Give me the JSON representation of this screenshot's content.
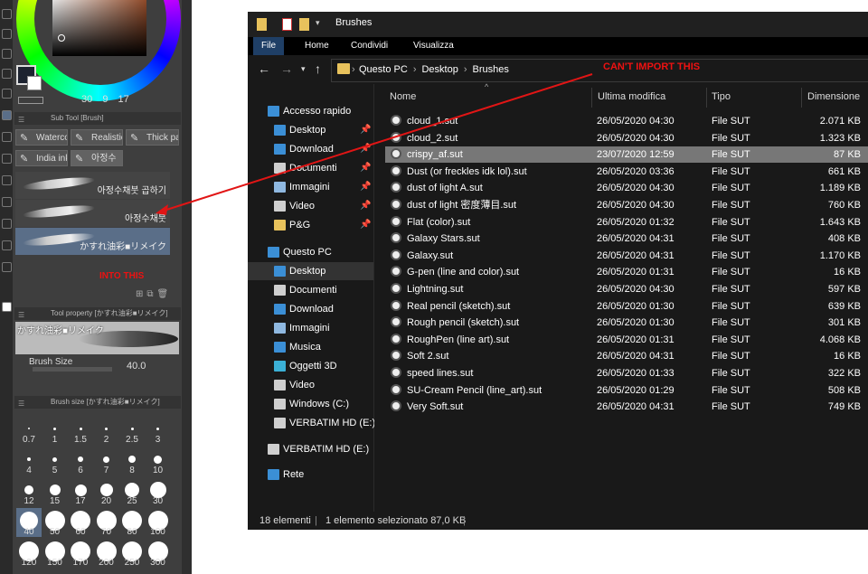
{
  "csp": {
    "color_values": [
      "30",
      "9",
      "17"
    ],
    "subtool_panel_title": "Sub Tool [Brush]",
    "tabs_row1": [
      "Watercolor",
      "Realistic",
      "Thick paint"
    ],
    "tabs_row2": [
      "India ink",
      "아정수"
    ],
    "brushes": [
      "아정수채붓 곱하기",
      "아정수채붓",
      "かすれ油彩■リメイク"
    ],
    "selected_brush": "かすれ油彩■リメイク",
    "into_this_label": "INTO THIS",
    "property_panel_title": "Tool property [かすれ油彩■リメイク]",
    "property_preview_label": "かすれ油彩■リメイク",
    "brush_size_label": "Brush Size",
    "brush_size_value": "40.0",
    "brush_size_panel_title": "Brush size [かすれ油彩■リメイク]",
    "sizes": [
      "0.7",
      "1",
      "1.5",
      "2",
      "2.5",
      "3",
      "4",
      "5",
      "6",
      "7",
      "8",
      "10",
      "12",
      "15",
      "17",
      "20",
      "25",
      "30",
      "40",
      "50",
      "60",
      "70",
      "80",
      "100",
      "120",
      "150",
      "170",
      "200",
      "250",
      "300"
    ],
    "selected_size": "40"
  },
  "explorer": {
    "title": "Brushes",
    "ribbon": [
      "File",
      "Home",
      "Condividi",
      "Visualizza"
    ],
    "breadcrumb": [
      "Questo PC",
      "Desktop",
      "Brushes"
    ],
    "nav": {
      "quick_access": "Accesso rapido",
      "quick_items": [
        "Desktop",
        "Download",
        "Documenti",
        "Immagini",
        "Video",
        "P&G"
      ],
      "this_pc": "Questo PC",
      "pc_items": [
        "Desktop",
        "Documenti",
        "Download",
        "Immagini",
        "Musica",
        "Oggetti 3D",
        "Video",
        "Windows (C:)",
        "VERBATIM HD (E:)"
      ],
      "verbatim": "VERBATIM HD (E:)",
      "network": "Rete"
    },
    "columns": [
      "Nome",
      "Ultima modifica",
      "Tipo",
      "Dimensione"
    ],
    "files": [
      {
        "name": "cloud_1.sut",
        "date": "26/05/2020 04:30",
        "type": "File SUT",
        "size": "2.071 KB"
      },
      {
        "name": "cloud_2.sut",
        "date": "26/05/2020 04:30",
        "type": "File SUT",
        "size": "1.323 KB"
      },
      {
        "name": "crispy_af.sut",
        "date": "23/07/2020 12:59",
        "type": "File SUT",
        "size": "87 KB"
      },
      {
        "name": "Dust (or freckles idk lol).sut",
        "date": "26/05/2020 03:36",
        "type": "File SUT",
        "size": "661 KB"
      },
      {
        "name": "dust of light A.sut",
        "date": "26/05/2020 04:30",
        "type": "File SUT",
        "size": "1.189 KB"
      },
      {
        "name": "dust of light 密度薄目.sut",
        "date": "26/05/2020 04:30",
        "type": "File SUT",
        "size": "760 KB"
      },
      {
        "name": "Flat (color).sut",
        "date": "26/05/2020 01:32",
        "type": "File SUT",
        "size": "1.643 KB"
      },
      {
        "name": "Galaxy Stars.sut",
        "date": "26/05/2020 04:31",
        "type": "File SUT",
        "size": "408 KB"
      },
      {
        "name": "Galaxy.sut",
        "date": "26/05/2020 04:31",
        "type": "File SUT",
        "size": "1.170 KB"
      },
      {
        "name": "G-pen (line and color).sut",
        "date": "26/05/2020 01:31",
        "type": "File SUT",
        "size": "16 KB"
      },
      {
        "name": "Lightning.sut",
        "date": "26/05/2020 04:30",
        "type": "File SUT",
        "size": "597 KB"
      },
      {
        "name": "Real pencil (sketch).sut",
        "date": "26/05/2020 01:30",
        "type": "File SUT",
        "size": "639 KB"
      },
      {
        "name": "Rough pencil (sketch).sut",
        "date": "26/05/2020 01:30",
        "type": "File SUT",
        "size": "301 KB"
      },
      {
        "name": "RoughPen (line art).sut",
        "date": "26/05/2020 01:31",
        "type": "File SUT",
        "size": "4.068 KB"
      },
      {
        "name": "Soft 2.sut",
        "date": "26/05/2020 04:31",
        "type": "File SUT",
        "size": "16 KB"
      },
      {
        "name": "speed lines.sut",
        "date": "26/05/2020 01:33",
        "type": "File SUT",
        "size": "322 KB"
      },
      {
        "name": "SU-Cream Pencil (line_art).sut",
        "date": "26/05/2020 01:29",
        "type": "File SUT",
        "size": "508 KB"
      },
      {
        "name": "Very Soft.sut",
        "date": "26/05/2020 04:31",
        "type": "File SUT",
        "size": "749 KB"
      }
    ],
    "selected_file": "crispy_af.sut",
    "status": {
      "count": "18 elementi",
      "selection": "1 elemento selezionato 87,0 KB"
    }
  },
  "annotation": {
    "text": "CAN'T IMPORT THIS",
    "color": "#e11515"
  },
  "colors": {
    "selection": "#777777",
    "nav_selected": "#333333",
    "folder": "#e8c25c",
    "brush_selected": "#5a6e88"
  }
}
